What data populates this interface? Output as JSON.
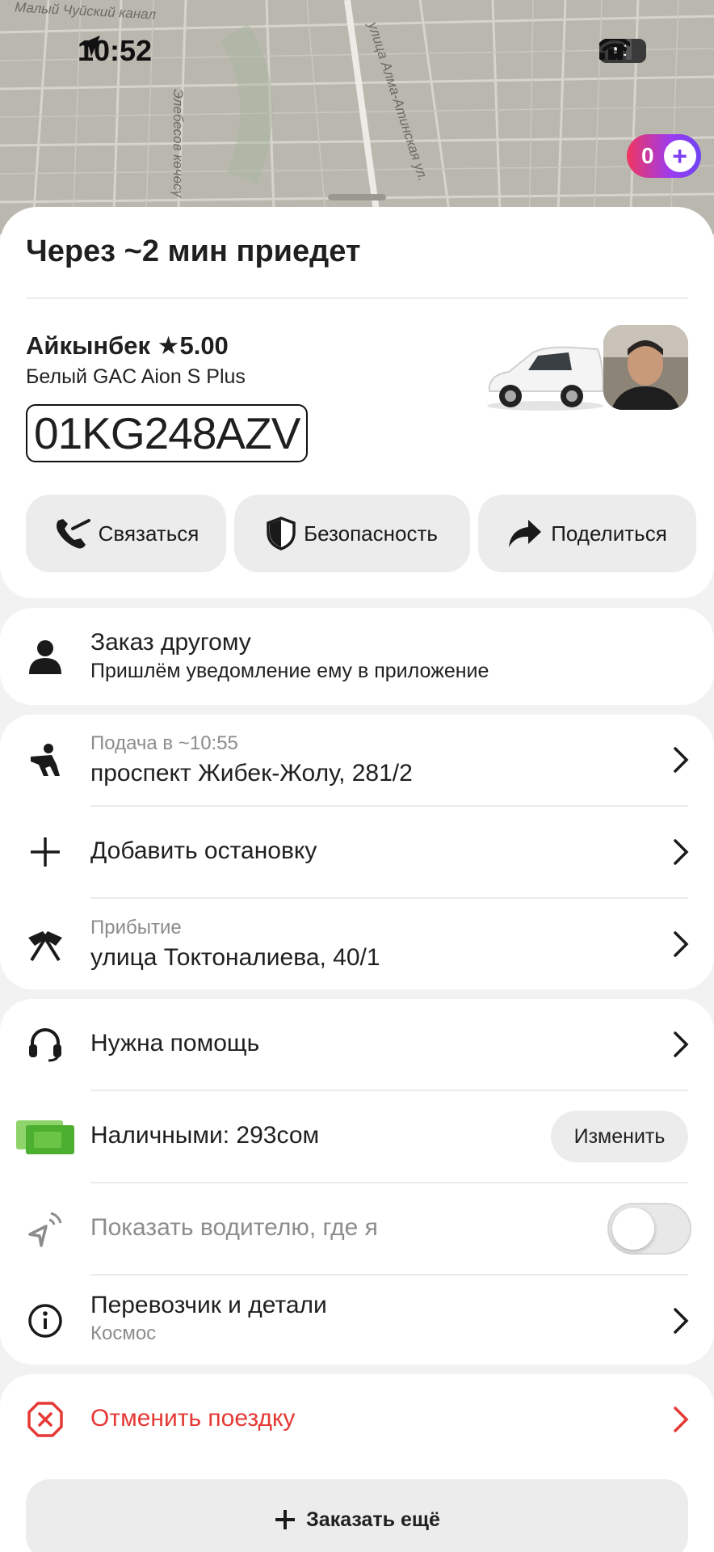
{
  "status_bar": {
    "time": "10:52",
    "battery": "51"
  },
  "map": {
    "labels": [
      "Малый Чуйский канал",
      "Элебесов көчөсү",
      "улица Алма-Атинская ул."
    ],
    "plus_count": "0"
  },
  "ride": {
    "eta_title": "Через ~2 мин приедет",
    "driver_name": "Айкынбек ★5.00",
    "car_model": "Белый GAC Aion S Plus",
    "plate": "01KG248AZV"
  },
  "actions": {
    "contact": "Связаться",
    "safety": "Безопасность",
    "share": "Поделиться"
  },
  "order_for_other": {
    "title": "Заказ другому",
    "subtitle": "Пришлём уведомление ему в приложение"
  },
  "route": {
    "pickup_label": "Подача в ~10:55",
    "pickup_address": "проспект Жибек-Жолу, 281/2",
    "add_stop": "Добавить остановку",
    "arrival_label": "Прибытие",
    "arrival_address": "улица Токтоналиева, 40/1"
  },
  "details": {
    "help": "Нужна помощь",
    "payment": "Наличными: 293сом",
    "change": "Изменить",
    "show_location": "Показать водителю, где я",
    "show_location_enabled": false,
    "carrier_title": "Перевозчик и детали",
    "carrier_name": "Космос"
  },
  "cancel": "Отменить поездку",
  "order_more": "Заказать ещё",
  "colors": {
    "cancel_red": "#e53935",
    "cash_green": "#4caf2f",
    "plus_gradient_start": "#f0365f",
    "plus_gradient_end": "#6f44f5"
  }
}
